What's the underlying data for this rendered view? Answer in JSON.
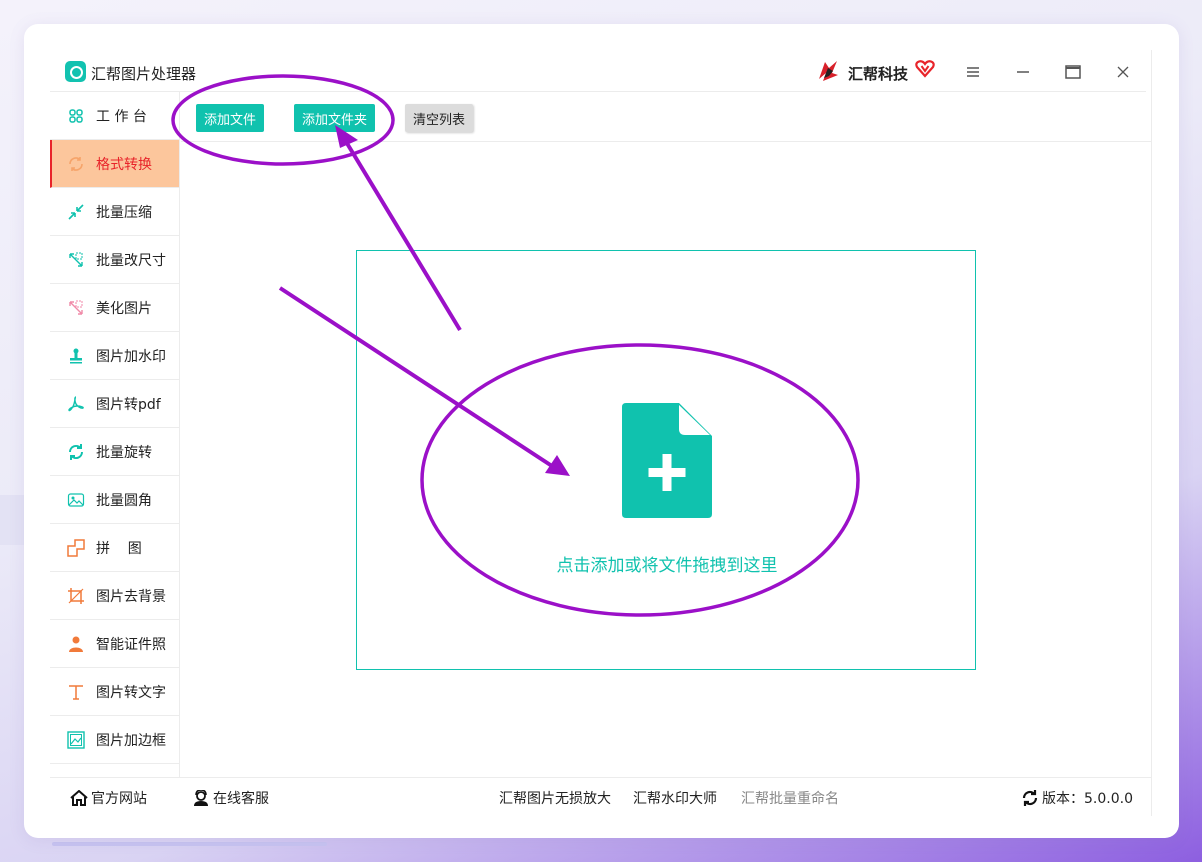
{
  "app": {
    "title": "汇帮图片处理器",
    "brand": "汇帮科技"
  },
  "window_controls": {
    "menu_icon": "menu-icon",
    "minimize_icon": "minimize-icon",
    "maximize_icon": "maximize-icon",
    "close_icon": "close-icon"
  },
  "sidebar": {
    "items": [
      {
        "label": "工 作 台",
        "icon": "grid-icon"
      },
      {
        "label": "格式转换",
        "icon": "convert-icon",
        "active": true
      },
      {
        "label": "批量压缩",
        "icon": "compress-icon"
      },
      {
        "label": "批量改尺寸",
        "icon": "resize-icon"
      },
      {
        "label": "美化图片",
        "icon": "beautify-icon"
      },
      {
        "label": "图片加水印",
        "icon": "watermark-icon"
      },
      {
        "label": "图片转pdf",
        "icon": "pdf-icon"
      },
      {
        "label": "批量旋转",
        "icon": "rotate-icon"
      },
      {
        "label": "批量圆角",
        "icon": "rounded-corner-icon"
      },
      {
        "label": "拼    图",
        "icon": "collage-icon"
      },
      {
        "label": "图片去背景",
        "icon": "crop-icon"
      },
      {
        "label": "智能证件照",
        "icon": "person-icon"
      },
      {
        "label": "图片转文字",
        "icon": "text-icon"
      },
      {
        "label": "图片加边框",
        "icon": "frame-icon"
      }
    ]
  },
  "toolbar": {
    "add_file": "添加文件",
    "add_folder": "添加文件夹",
    "clear_list": "清空列表"
  },
  "dropzone": {
    "hint": "点击添加或将文件拖拽到这里"
  },
  "footer": {
    "website": "官方网站",
    "support": "在线客服",
    "link1": "汇帮图片无损放大",
    "link2": "汇帮水印大师",
    "link3": "汇帮批量重命名",
    "version": "版本：5.0.0.0"
  },
  "colors": {
    "accent": "#10c2ae",
    "active_bg": "#fcc69c",
    "active_text": "#e8242a",
    "annotation": "#9b10c8"
  }
}
